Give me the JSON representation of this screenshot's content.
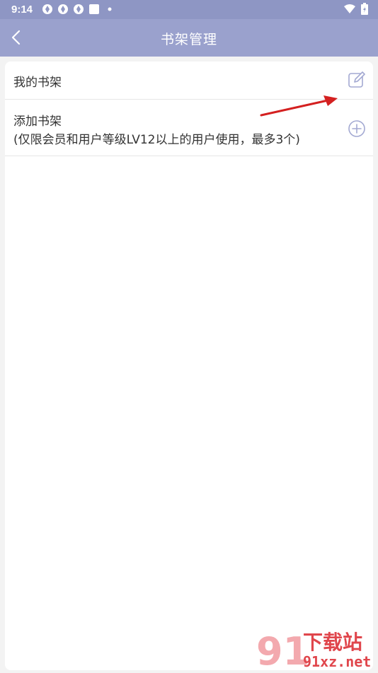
{
  "status": {
    "time": "9:14"
  },
  "header": {
    "title": "书架管理"
  },
  "rows": [
    {
      "label": "我的书架",
      "icon": "edit-icon"
    },
    {
      "label": "添加书架",
      "sub": "(仅限会员和用户等级LV12以上的用户使用，最多3个)",
      "icon": "add-circle-icon"
    }
  ],
  "watermark": {
    "main": "下载站",
    "site": "91xz.net",
    "logo": "91"
  },
  "colors": {
    "header": "#9aa1cd",
    "statusbar": "#8e96c4",
    "accent": "#a3a9d2",
    "annotation_arrow": "#d42020"
  }
}
